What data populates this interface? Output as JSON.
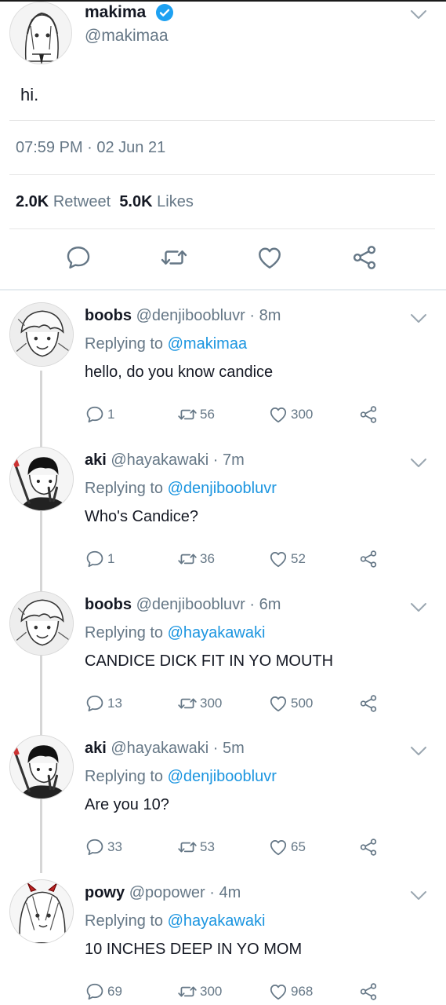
{
  "main_tweet": {
    "name": "makima",
    "handle": "@makimaa",
    "text": "hi.",
    "timestamp": "07:59 PM · 02 Jun 21",
    "retweet_count": "2.0K",
    "retweet_label": "Retweet",
    "like_count": "5.0K",
    "like_label": "Likes",
    "verified_color": "#1da1f2"
  },
  "replies": [
    {
      "name": "boobs",
      "handle": "@denjiboobluvr",
      "time": "· 8m",
      "replying_prefix": "Replying to",
      "replying_to": "@makimaa",
      "text": "hello, do you know candice",
      "reply_count": "1",
      "retweet_count": "56",
      "like_count": "300"
    },
    {
      "name": "aki",
      "handle": "@hayakawaki",
      "time": "· 7m",
      "replying_prefix": "Replying to",
      "replying_to": "@denjiboobluvr",
      "text": "Who's Candice?",
      "reply_count": "1",
      "retweet_count": "36",
      "like_count": "52"
    },
    {
      "name": "boobs",
      "handle": "@denjiboobluvr",
      "time": "· 6m",
      "replying_prefix": "Replying to",
      "replying_to": "@hayakawaki",
      "text": "CANDICE DICK FIT IN YO MOUTH",
      "reply_count": "13",
      "retweet_count": "300",
      "like_count": "500"
    },
    {
      "name": "aki",
      "handle": "@hayakawaki",
      "time": "· 5m",
      "replying_prefix": "Replying to",
      "replying_to": "@denjiboobluvr",
      "text": "Are you 10?",
      "reply_count": "33",
      "retweet_count": "53",
      "like_count": "65"
    },
    {
      "name": "powy",
      "handle": "@popower",
      "time": "· 4m",
      "replying_prefix": "Replying to",
      "replying_to": "@hayakawaki",
      "text": "10 INCHES DEEP IN YO MOM",
      "reply_count": "69",
      "retweet_count": "300",
      "like_count": "968"
    }
  ],
  "colors": {
    "link": "#1b95e0",
    "secondary": "#657786",
    "text": "#141823"
  },
  "icons": [
    "reply-icon",
    "retweet-icon",
    "like-icon",
    "share-icon",
    "chevron-down-icon",
    "verified-badge-icon"
  ]
}
